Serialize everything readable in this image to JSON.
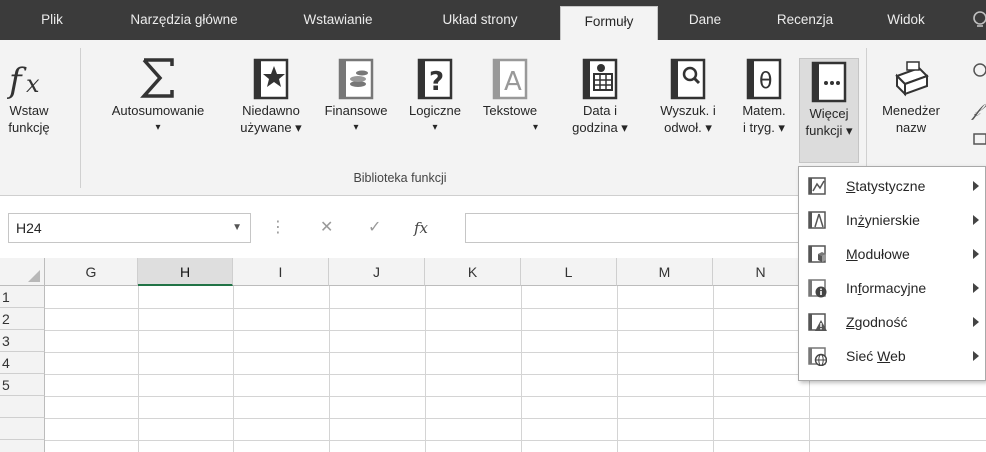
{
  "tabs": [
    {
      "label": "Plik",
      "active": false
    },
    {
      "label": "Narzędzia główne",
      "active": false
    },
    {
      "label": "Wstawianie",
      "active": false
    },
    {
      "label": "Układ strony",
      "active": false
    },
    {
      "label": "Formuły",
      "active": true
    },
    {
      "label": "Dane",
      "active": false
    },
    {
      "label": "Recenzja",
      "active": false
    },
    {
      "label": "Widok",
      "active": false
    }
  ],
  "ribbon": {
    "insert_function": {
      "line1": "Wstaw",
      "line2": "funkcję"
    },
    "autosum": {
      "line1": "Autosumowanie",
      "line2": "▾"
    },
    "recent": {
      "line1": "Niedawno",
      "line2": "używane ▾"
    },
    "financial": {
      "line1": "Finansowe",
      "line2": "▾"
    },
    "logical": {
      "line1": "Logiczne",
      "line2": "▾"
    },
    "text": {
      "line1": "Tekstowe",
      "line2": "▾"
    },
    "datetime": {
      "line1": "Data i",
      "line2": "godzina ▾"
    },
    "lookup": {
      "line1": "Wyszuk. i",
      "line2": "odwoł. ▾"
    },
    "math": {
      "line1": "Matem.",
      "line2": "i tryg. ▾"
    },
    "more": {
      "line1": "Więcej",
      "line2": "funkcji ▾"
    },
    "name_manager": {
      "line1": "Menedżer",
      "line2": "nazw"
    },
    "group_label": "Biblioteka funkcji"
  },
  "formula_bar": {
    "name_box": "H24",
    "fx_label": "fx",
    "formula": ""
  },
  "grid": {
    "columns": [
      "G",
      "H",
      "I",
      "J",
      "K",
      "L",
      "M",
      "N"
    ],
    "selected_column": "H",
    "rows": [
      "1",
      "2",
      "3",
      "4",
      "5"
    ]
  },
  "more_functions_menu": [
    {
      "label": "Statystyczne",
      "accel": "S",
      "icon": "statistical-icon"
    },
    {
      "label": "Inżynierskie",
      "accel": "ż",
      "icon": "engineering-icon"
    },
    {
      "label": "Modułowe",
      "accel": "M",
      "icon": "cube-icon"
    },
    {
      "label": "Informacyjne",
      "accel": "f",
      "icon": "information-icon"
    },
    {
      "label": "Zgodność",
      "accel": "Z",
      "icon": "compatibility-icon"
    },
    {
      "label": "Sieć Web",
      "accel": "W",
      "icon": "web-icon"
    }
  ],
  "colors": {
    "tabbar": "#3b3b3b",
    "ribbon": "#f3f3f3",
    "selection_accent": "#217346"
  }
}
